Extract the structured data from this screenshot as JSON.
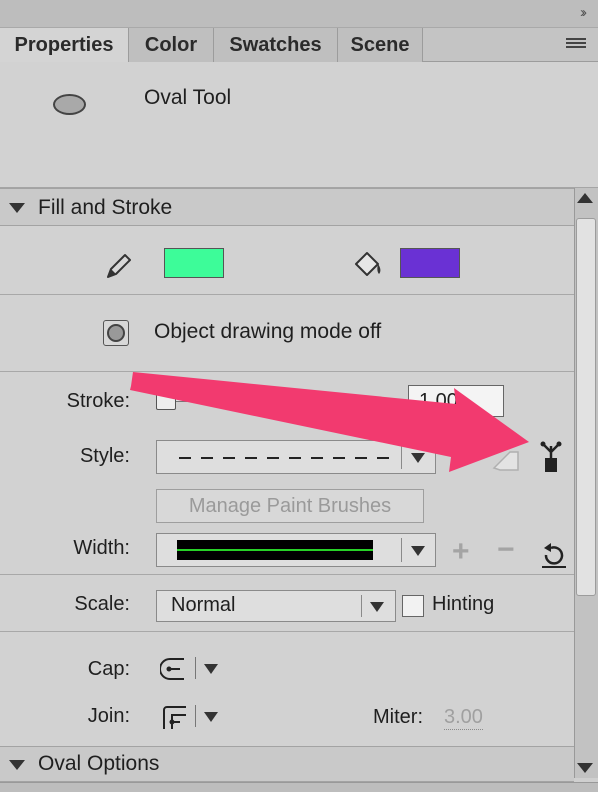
{
  "tabs": [
    "Properties",
    "Color",
    "Swatches",
    "Scene"
  ],
  "tool": {
    "name": "Oval Tool",
    "icon": "oval-icon"
  },
  "fill_stroke": {
    "header": "Fill and Stroke",
    "stroke_color": "#3dfc99",
    "fill_color": "#6a31d4",
    "object_drawing_label": "Object drawing mode off",
    "stroke_label": "Stroke:",
    "stroke_value": "1.00",
    "style_label": "Style:",
    "manage_brushes_label": "Manage Paint Brushes",
    "width_label": "Width:",
    "scale_label": "Scale:",
    "scale_value": "Normal",
    "hinting_label": "Hinting",
    "cap_label": "Cap:",
    "join_label": "Join:",
    "miter_label": "Miter:",
    "miter_value": "3.00"
  },
  "oval_options": {
    "header": "Oval Options"
  },
  "colors": {
    "annotation_arrow": "#f23a6f",
    "width_profile_line": "#27d227"
  }
}
